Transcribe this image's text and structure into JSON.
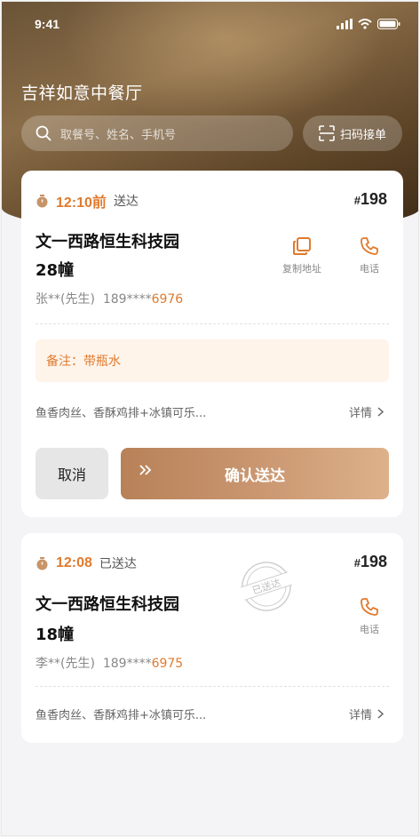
{
  "status_bar": {
    "time": "9:41"
  },
  "restaurant_name": "吉祥如意中餐厅",
  "search": {
    "placeholder": "取餐号、姓名、手机号"
  },
  "scan_button": {
    "label": "扫码接单"
  },
  "orders": [
    {
      "deadline": "12:10前",
      "status": "送达",
      "order_hash": "#",
      "order_number": "198",
      "address_line1": "文一西路恒生科技园",
      "address_line2": "28幢",
      "contact_name": "张**(先生)",
      "phone_masked": "189****",
      "phone_tail": "6976",
      "copy_label": "复制地址",
      "phone_label": "电话",
      "note": "备注：带瓶水",
      "items": "鱼香肉丝、香酥鸡排+冰镇可乐...",
      "details_label": "详情",
      "cancel_label": "取消",
      "confirm_label": "确认送达"
    },
    {
      "deadline": "12:08",
      "status": "已送达",
      "order_hash": "#",
      "order_number": "198",
      "address_line1": "文一西路恒生科技园",
      "address_line2": "18幢",
      "contact_name": "李**(先生)",
      "phone_masked": "189****",
      "phone_tail": "6975",
      "phone_label": "电话",
      "stamp_text": "已送达",
      "items": "鱼香肉丝、香酥鸡排+冰镇可乐...",
      "details_label": "详情"
    }
  ],
  "colors": {
    "accent": "#e07a2e",
    "brand_brown": "#b88158",
    "note_bg": "#fff4ea"
  },
  "icons": [
    "search-icon",
    "scan-icon",
    "timer-icon",
    "copy-icon",
    "phone-icon",
    "chevron-right-icon",
    "double-chevron-icon",
    "signal-icon",
    "wifi-icon",
    "battery-icon"
  ]
}
